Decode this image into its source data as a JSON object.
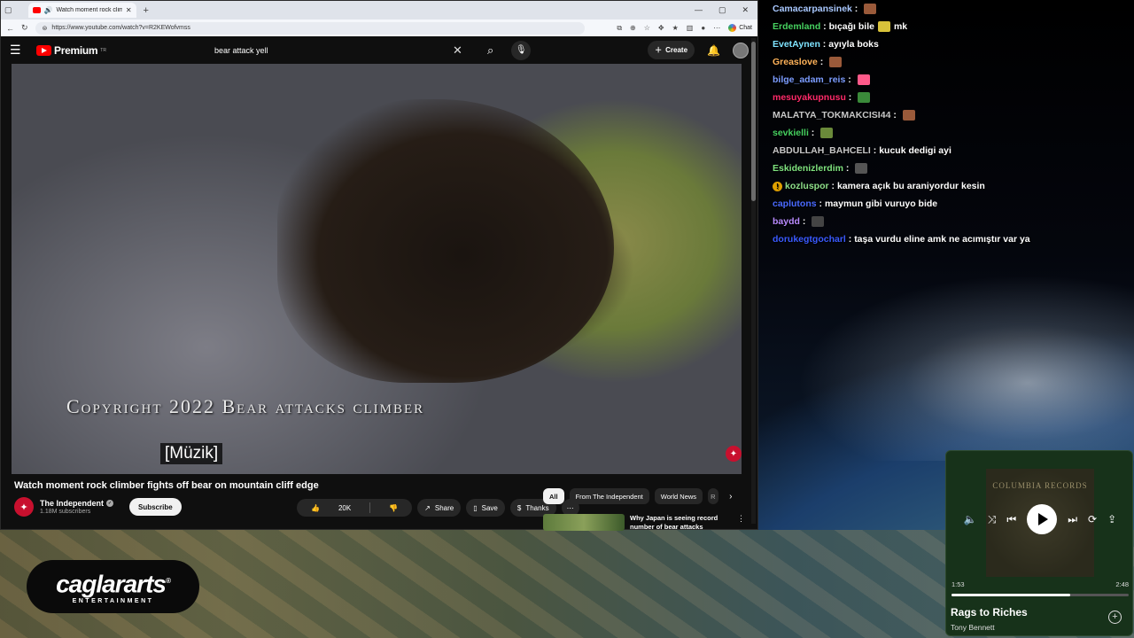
{
  "browser": {
    "tab_title": "Watch moment rock climbe",
    "url": "https://www.youtube.com/watch?v=R2KEWofvmss",
    "chat_label": "Chat"
  },
  "youtube": {
    "brand": "Premium",
    "brand_sup": "TR",
    "search_query": "bear attack yell",
    "create_label": "Create",
    "video": {
      "copyright_overlay": "Copyright 2022 Bear attacks climber",
      "caption": "[Müzik]",
      "title": "Watch moment rock climber fights off bear on mountain cliff edge"
    },
    "channel": {
      "name": "The Independent",
      "subscribers": "1.18M subscribers",
      "subscribe_label": "Subscribe"
    },
    "actions": {
      "likes": "20K",
      "share": "Share",
      "save": "Save",
      "thanks": "Thanks"
    },
    "chips": [
      "All",
      "From The Independent",
      "World News",
      "R"
    ],
    "recommended": {
      "title": "Why Japan is seeing record number of bear attacks"
    }
  },
  "chat": [
    {
      "user": "Camacarpansinek",
      "color": "#a9c8ff",
      "text": "",
      "emote": "#9a5a3a"
    },
    {
      "user": "Erdemland",
      "color": "#46d160",
      "text": "bıçağı bile",
      "emote": "#d8c23a",
      "text2": "mk"
    },
    {
      "user": "EvetAynen",
      "color": "#7fe3ff",
      "text": "ayıyla boks"
    },
    {
      "user": "Greaslove",
      "color": "#ffb35a",
      "text": "",
      "emote": "#9a5a3a"
    },
    {
      "user": "bilge_adam_reis",
      "color": "#7c9dff",
      "text": "",
      "emote": "#ff5a8a"
    },
    {
      "user": "mesuyakupnusu",
      "color": "#ff2a6a",
      "text": "",
      "emote": "#3a8a3a"
    },
    {
      "user": "MALATYA_TOKMAKCISI44",
      "color": "#c7c7c7",
      "text": "",
      "emote": "#9a5a3a"
    },
    {
      "user": "sevkielli",
      "color": "#46d160",
      "text": "",
      "emote": "#6a8a3a"
    },
    {
      "user": "ABDULLAH_BAHCELI",
      "color": "#c7c7c7",
      "text": "kucuk dedigi ayi"
    },
    {
      "user": "Eskidenizlerdim",
      "color": "#7fe37f",
      "text": "",
      "emote": "#555555"
    },
    {
      "user": "kozluspor",
      "color": "#8fe08a",
      "text": "kamera açık bu araniyordur kesin",
      "badge": "!"
    },
    {
      "user": "caplutons",
      "color": "#4a6aff",
      "text": "maymun gibi vuruyo bide"
    },
    {
      "user": "baydd",
      "color": "#b98bff",
      "text": "",
      "emote": "#444444"
    },
    {
      "user": "dorukegtgocharl",
      "color": "#3a5aff",
      "text": "taşa vurdu eline amk ne acımıştır var ya"
    }
  ],
  "logo": {
    "main": "caglararts",
    "sub": "ENTERTAINMENT",
    "reg": "®"
  },
  "player": {
    "album_text": "COLUMBIA RECORDS",
    "elapsed": "1:53",
    "duration": "2:48",
    "progress_fraction": 0.67,
    "song": "Rags to Riches",
    "artist": "Tony Bennett"
  }
}
